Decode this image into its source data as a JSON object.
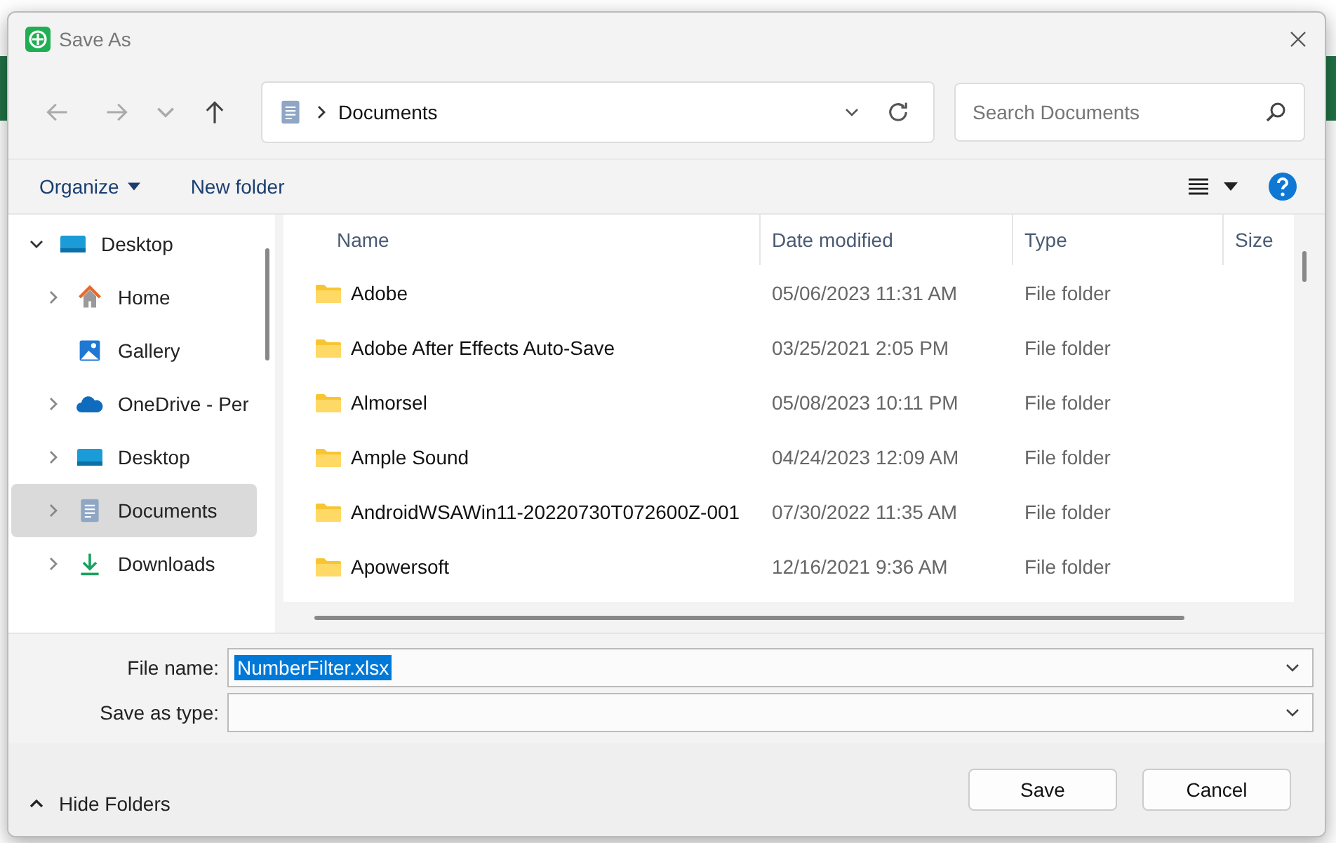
{
  "window": {
    "title": "Save As"
  },
  "address": {
    "crumb": "Documents"
  },
  "search": {
    "placeholder": "Search Documents"
  },
  "toolbar": {
    "organize": "Organize",
    "new_folder": "New folder"
  },
  "sidebar": {
    "items": [
      {
        "label": "Desktop",
        "kind": "desktop",
        "expandable": true,
        "expanded": true,
        "selected": false,
        "children": [
          {
            "label": "Home",
            "kind": "home",
            "expandable": true,
            "expanded": false,
            "selected": false
          },
          {
            "label": "Gallery",
            "kind": "gallery",
            "expandable": false,
            "expanded": false,
            "selected": false
          },
          {
            "label": "OneDrive - Per",
            "kind": "cloud",
            "expandable": true,
            "expanded": false,
            "selected": false
          },
          {
            "label": "Desktop",
            "kind": "desktop",
            "expandable": true,
            "expanded": false,
            "selected": false
          },
          {
            "label": "Documents",
            "kind": "documents",
            "expandable": true,
            "expanded": false,
            "selected": true
          },
          {
            "label": "Downloads",
            "kind": "downloads",
            "expandable": true,
            "expanded": false,
            "selected": false
          }
        ]
      }
    ]
  },
  "table": {
    "columns": [
      "Name",
      "Date modified",
      "Type",
      "Size"
    ],
    "rows": [
      {
        "name": "Adobe",
        "date": "05/06/2023 11:31 AM",
        "type": "File folder"
      },
      {
        "name": "Adobe After Effects Auto-Save",
        "date": "03/25/2021 2:05 PM",
        "type": "File folder"
      },
      {
        "name": "Almorsel",
        "date": "05/08/2023 10:11 PM",
        "type": "File folder"
      },
      {
        "name": "Ample Sound",
        "date": "04/24/2023 12:09 AM",
        "type": "File folder"
      },
      {
        "name": "AndroidWSAWin11-20220730T072600Z-001",
        "date": "07/30/2022 11:35 AM",
        "type": "File folder"
      },
      {
        "name": "Apowersoft",
        "date": "12/16/2021 9:36 AM",
        "type": "File folder"
      }
    ]
  },
  "fields": [
    {
      "label": "File name:",
      "value": "NumberFilter.xlsx",
      "highlighted": true
    },
    {
      "label": "Save as type:",
      "highlighted": false
    }
  ],
  "hide_folders": "Hide Folders",
  "buttons": [
    "Save",
    "Cancel"
  ]
}
